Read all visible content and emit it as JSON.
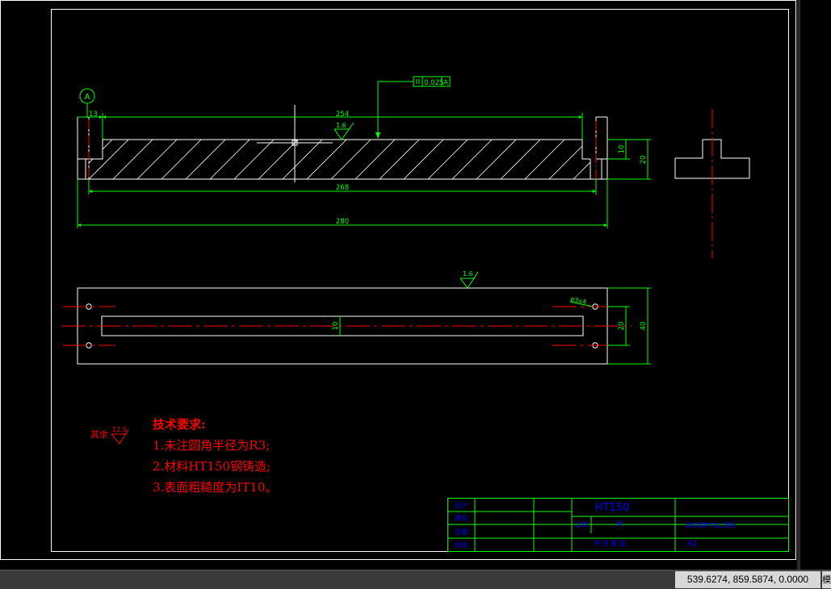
{
  "colors": {
    "background": "#000000",
    "outline": "#ffffff",
    "dimension": "#00ff00",
    "centerline": "#ff0000",
    "notes": "#ff0000",
    "title_text": "#0000ff",
    "statusbar": "#3a3a3a"
  },
  "datum": {
    "label": "A"
  },
  "tolerance": {
    "value": "0.025",
    "datum": "A"
  },
  "front_view": {
    "dims": {
      "left_offset": "13",
      "inner_length": "254",
      "hole_span": "268",
      "total_length": "280",
      "step_height": "10",
      "total_height": "20"
    },
    "roughness_top": "1.6"
  },
  "top_view": {
    "roughness": "1.6",
    "hole_callout": "ø3x4",
    "slot_width": "10",
    "inner_width": "20",
    "total_width": "40"
  },
  "notes": {
    "other_prefix": "其余",
    "other_roughness": "12.5",
    "title": "技术要求:",
    "items": [
      "1.未注圆角半径为R3;",
      "2.材料HT150钢铸造;",
      "3.表面粗糙度为IT10。"
    ]
  },
  "title_block": {
    "material": "HT150",
    "left_labels": [
      "设计",
      "审核",
      "日期",
      "校核"
    ],
    "scale_label": "比例",
    "scale_value": "M",
    "company": "共 张 第 张",
    "part_name": "齿轮轴零件加工图纸",
    "sheet": "A3"
  },
  "status": {
    "coordinates": "539.6274, 859.5874, 0.0000",
    "mode_glyph": "模"
  }
}
